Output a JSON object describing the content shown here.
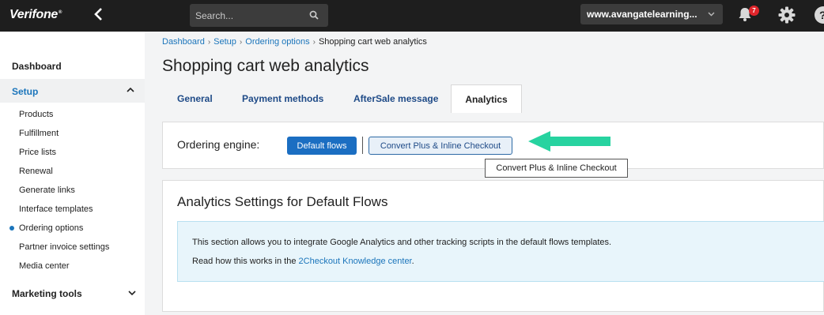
{
  "topbar": {
    "logo": "Verifone",
    "logo_mark": "®",
    "search_placeholder": "Search...",
    "account": "www.avangatelearning...",
    "notification_count": "7",
    "help_glyph": "?"
  },
  "sidebar": {
    "dashboard": "Dashboard",
    "setup": "Setup",
    "items": [
      "Products",
      "Fulfillment",
      "Price lists",
      "Renewal",
      "Generate links",
      "Interface templates",
      "Ordering options",
      "Partner invoice settings",
      "Media center"
    ],
    "active_item": "Ordering options",
    "marketing_tools": "Marketing tools"
  },
  "breadcrumb": {
    "items": [
      "Dashboard",
      "Setup",
      "Ordering options"
    ],
    "current": "Shopping cart web analytics"
  },
  "page_title": "Shopping cart web analytics",
  "tabs": [
    {
      "label": "General",
      "active": false
    },
    {
      "label": "Payment methods",
      "active": false
    },
    {
      "label": "AfterSale message",
      "active": false
    },
    {
      "label": "Analytics",
      "active": true
    }
  ],
  "ordering_engine": {
    "label": "Ordering engine:",
    "default_button": "Default flows",
    "convert_button": "Convert Plus & Inline Checkout",
    "tooltip": "Convert Plus & Inline Checkout"
  },
  "analytics_section": {
    "title": "Analytics Settings for Default Flows",
    "info_line1": "This section allows you to integrate Google Analytics and other tracking scripts in the default flows templates.",
    "info_line2_prefix": "Read how this works in the ",
    "info_link": "2Checkout Knowledge center",
    "info_line2_suffix": "."
  },
  "colors": {
    "topbar_bg": "#1e1e1e",
    "accent_blue": "#1b6ec2",
    "arrow_green": "#27d3a0",
    "badge_red": "#e0252b",
    "info_bg": "#e8f5fb"
  }
}
